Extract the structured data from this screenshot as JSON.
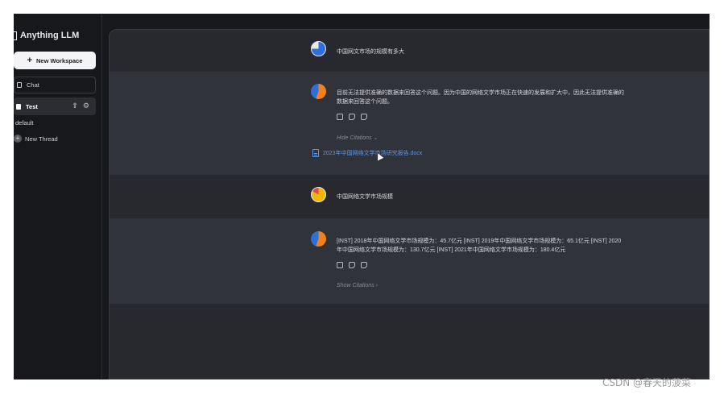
{
  "app": {
    "title": "Anything LLM"
  },
  "sidebar": {
    "new_workspace_label": "New Workspace",
    "workspaces": [
      {
        "label": "Chat"
      },
      {
        "label": "Test"
      }
    ],
    "threads": [
      {
        "label": "default"
      },
      {
        "label": "New Thread"
      }
    ]
  },
  "conversation": [
    {
      "role": "user",
      "text": "中国网文市场的规模有多大"
    },
    {
      "role": "assistant",
      "text": "目前无法提供准确的数据来回答这个问题。因为中国的网络文学市场正在快速的发展和扩大中，因此无法提供准确的数据来回答这个问题。",
      "citation_toggle": "Hide Citations",
      "citation_file": "2023年中国网络文学市场研究报告.docx"
    },
    {
      "role": "user",
      "text": "中国网络文学市场规模"
    },
    {
      "role": "assistant",
      "text": "[INST] 2018年中国网络文学市场规模为：45.7亿元 [INST] 2019年中国网络文学市场规模为：65.1亿元 [INST] 2020年中国网络文学市场规模为：130.7亿元 [INST] 2021年中国网络文学市场规模为：180.4亿元",
      "citation_toggle": "Show Citations"
    }
  ],
  "icons": {
    "copy": "clipboard-icon",
    "like": "thumbs-up-icon",
    "dislike": "thumbs-down-icon"
  },
  "colors": {
    "background": "#17181b",
    "main_panel": "#27292e",
    "assistant_row": "#31333a",
    "link": "#5d96e6",
    "button_bg": "#f4f4f6"
  },
  "watermark": "CSDN @春天的菠菜"
}
